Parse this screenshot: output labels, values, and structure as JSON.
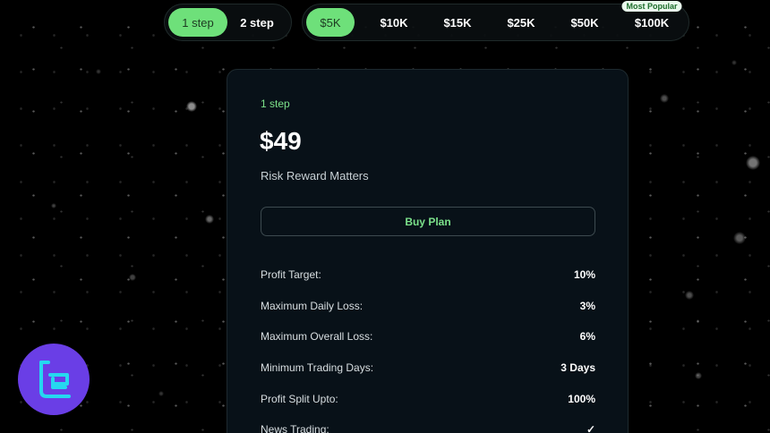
{
  "step_toggle": {
    "options": [
      {
        "label": "1 step",
        "active": true
      },
      {
        "label": "2 step",
        "active": false
      }
    ]
  },
  "amount_toggle": {
    "options": [
      {
        "label": "$5K",
        "active": true
      },
      {
        "label": "$10K",
        "active": false
      },
      {
        "label": "$15K",
        "active": false
      },
      {
        "label": "$25K",
        "active": false
      },
      {
        "label": "$50K",
        "active": false
      },
      {
        "label": "$100K",
        "active": false,
        "badge": "Most Popular"
      }
    ]
  },
  "plan": {
    "step_label": "1 step",
    "price": "$49",
    "tagline": "Risk Reward Matters",
    "buy_label": "Buy Plan",
    "specs": [
      {
        "label": "Profit Target:",
        "value": "10%"
      },
      {
        "label": "Maximum Daily Loss:",
        "value": "3%"
      },
      {
        "label": "Maximum Overall Loss:",
        "value": "6%"
      },
      {
        "label": "Minimum Trading Days:",
        "value": "3 Days"
      },
      {
        "label": "Profit Split Upto:",
        "value": "100%"
      },
      {
        "label": "News Trading:",
        "value": "✓"
      }
    ]
  },
  "logo": {
    "icon": "tradingfinder-logo-icon"
  },
  "colors": {
    "accent": "#6ee07a",
    "accent_text": "#7be08a",
    "card_bg": "#081118",
    "logo_bg": "#6a3ee6",
    "logo_mark": "#25d8f0"
  }
}
